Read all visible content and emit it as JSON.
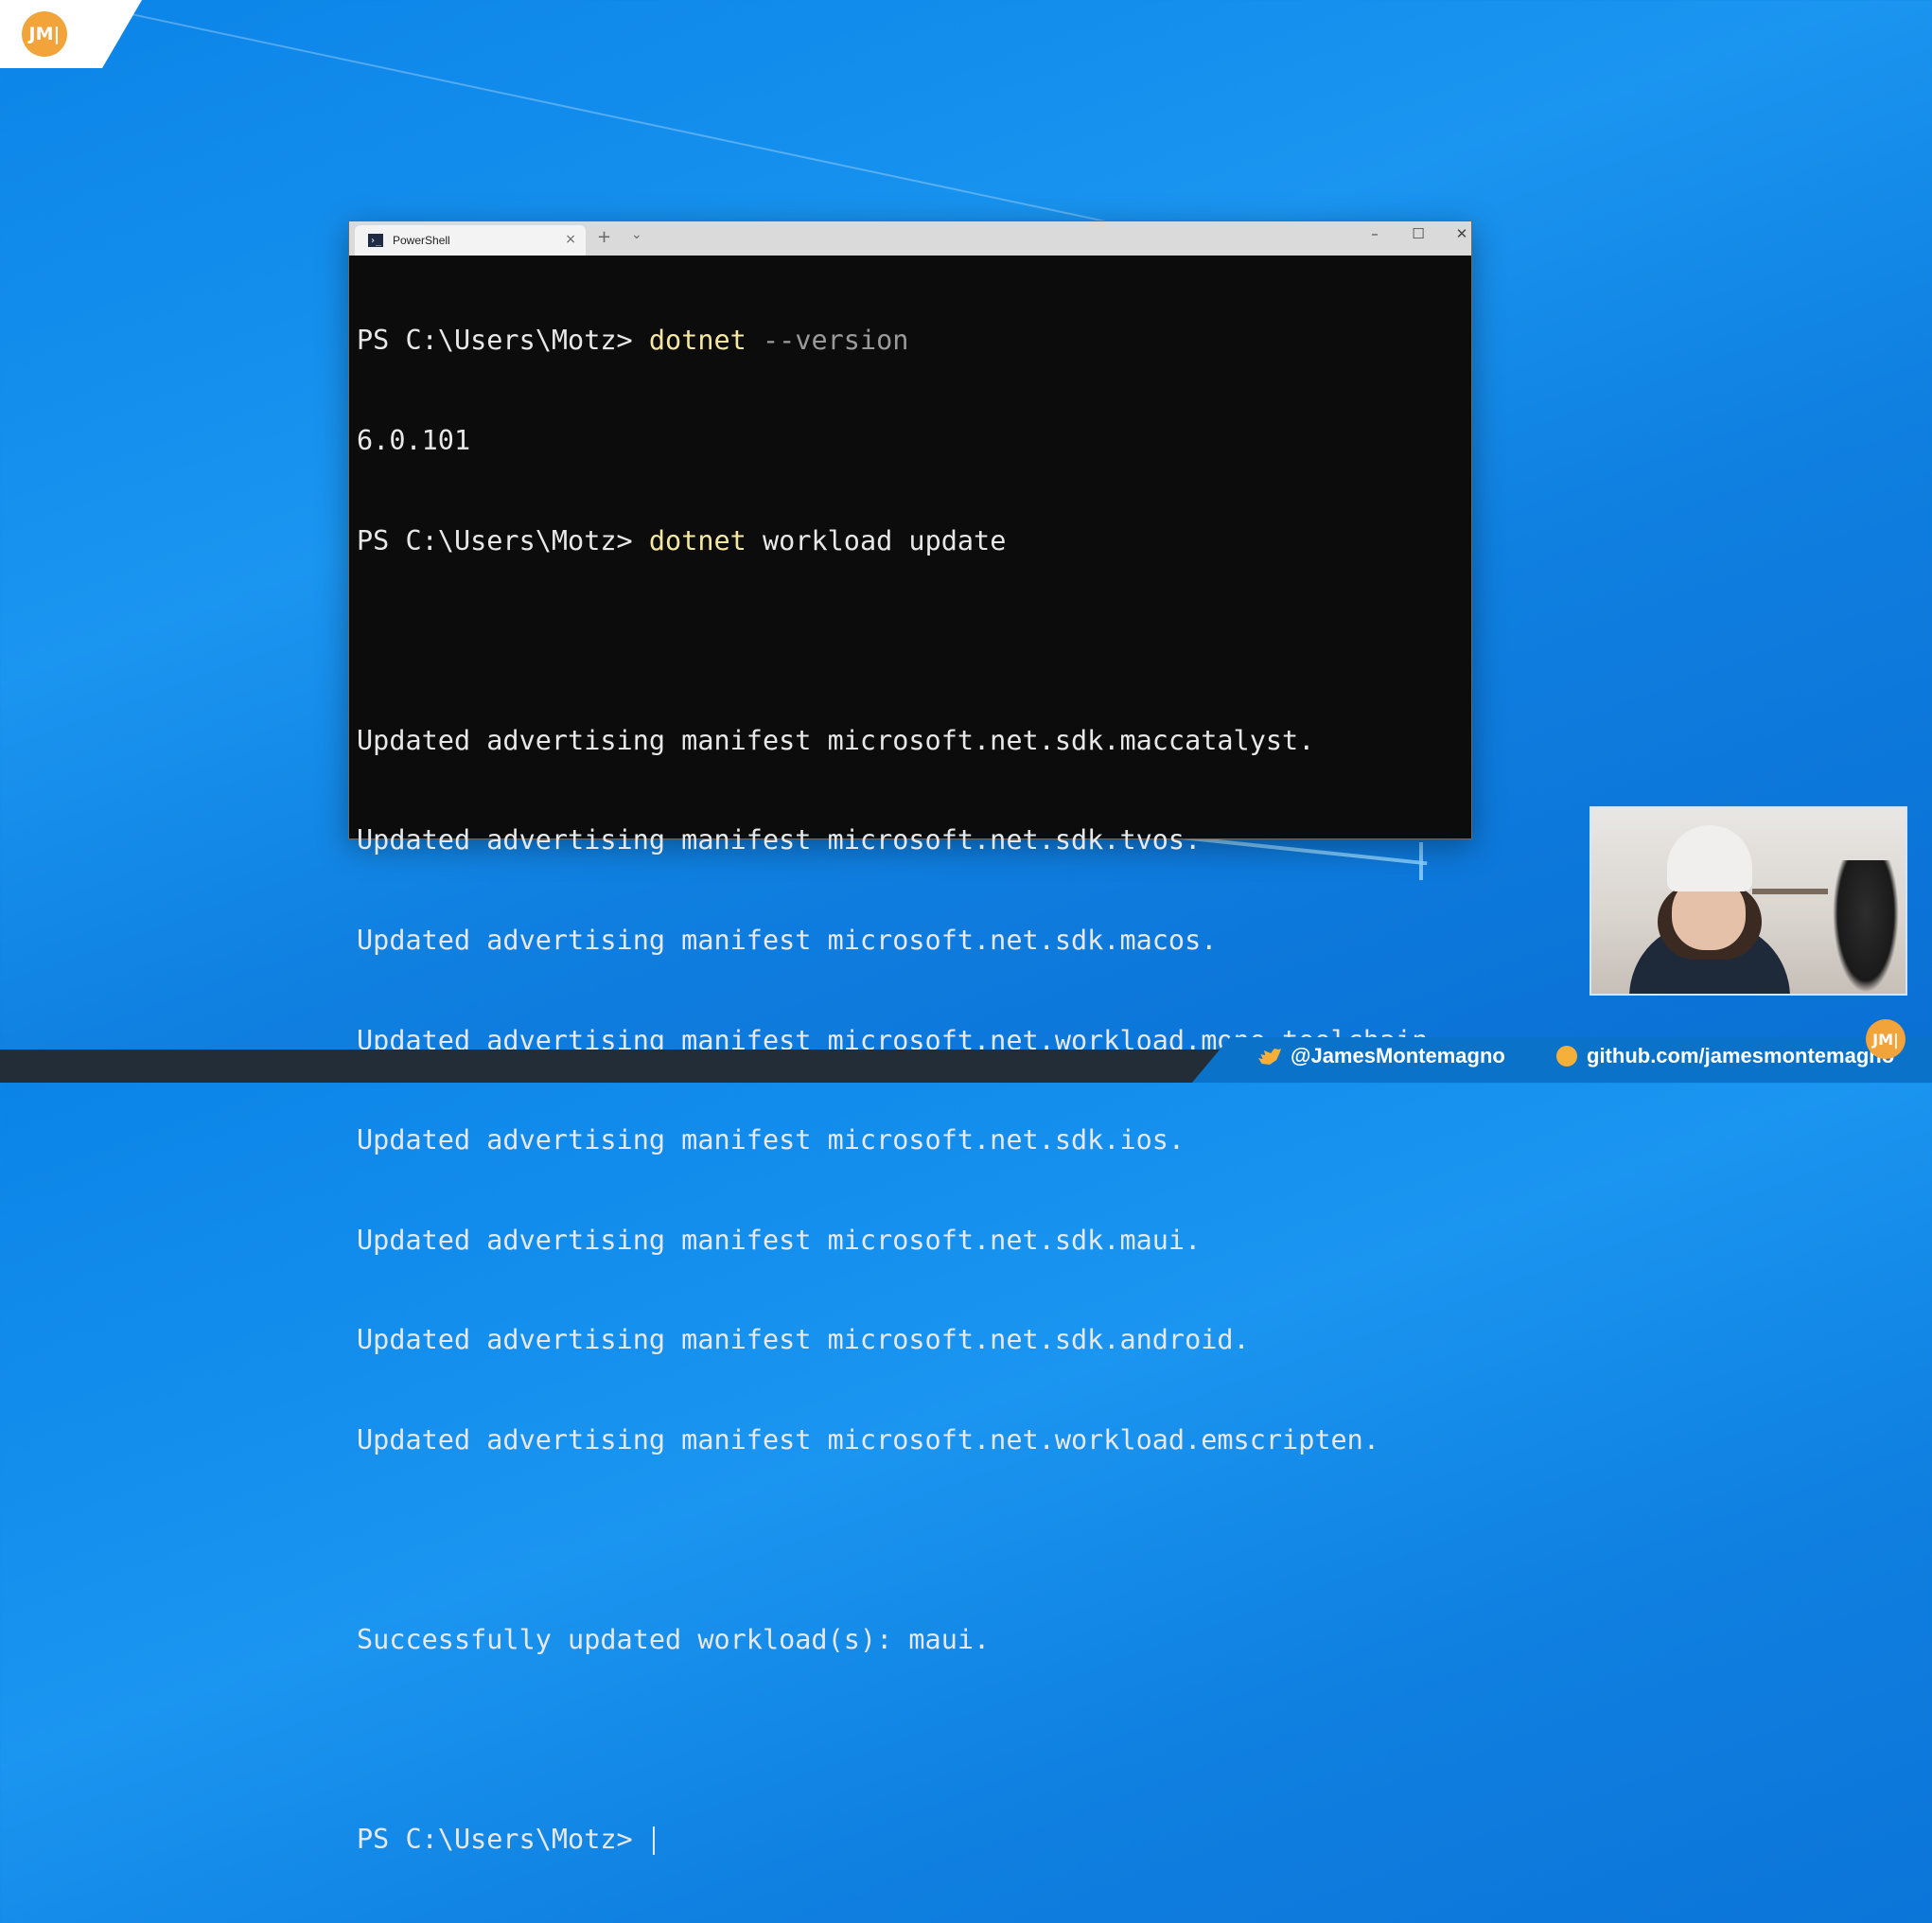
{
  "branding": {
    "logo_text": "JM|"
  },
  "window": {
    "tab_title": "PowerShell",
    "tab_close_glyph": "×",
    "newtab_glyph": "+",
    "dropdown_glyph": "⌄",
    "minimize_glyph": "–",
    "maximize_glyph": "☐",
    "close_glyph": "✕"
  },
  "terminal": {
    "prompt": "PS C:\\Users\\Motz>",
    "cmd1": {
      "exe": "dotnet",
      "args": "--version"
    },
    "version_output": "6.0.101",
    "cmd2": {
      "exe": "dotnet",
      "args": "workload update"
    },
    "manifest_lines": [
      "Updated advertising manifest microsoft.net.sdk.maccatalyst.",
      "Updated advertising manifest microsoft.net.sdk.tvos.",
      "Updated advertising manifest microsoft.net.sdk.macos.",
      "Updated advertising manifest microsoft.net.workload.mono.toolchain.",
      "Updated advertising manifest microsoft.net.sdk.ios.",
      "Updated advertising manifest microsoft.net.sdk.maui.",
      "Updated advertising manifest microsoft.net.sdk.android.",
      "Updated advertising manifest microsoft.net.workload.emscripten."
    ],
    "success_line": "Successfully updated workload(s): maui."
  },
  "footer": {
    "twitter": "@JamesMontemagno",
    "github": "github.com/jamesmontemagno",
    "badge_text": "JM|"
  },
  "colors": {
    "desktop": "#0b84e8",
    "terminal_bg": "#0c0c0c",
    "command_yellow": "#f7e8a1",
    "accent_orange": "#f2a33a"
  },
  "icons": [
    "powershell-icon",
    "twitter-icon",
    "github-icon",
    "jm-logo-icon"
  ]
}
